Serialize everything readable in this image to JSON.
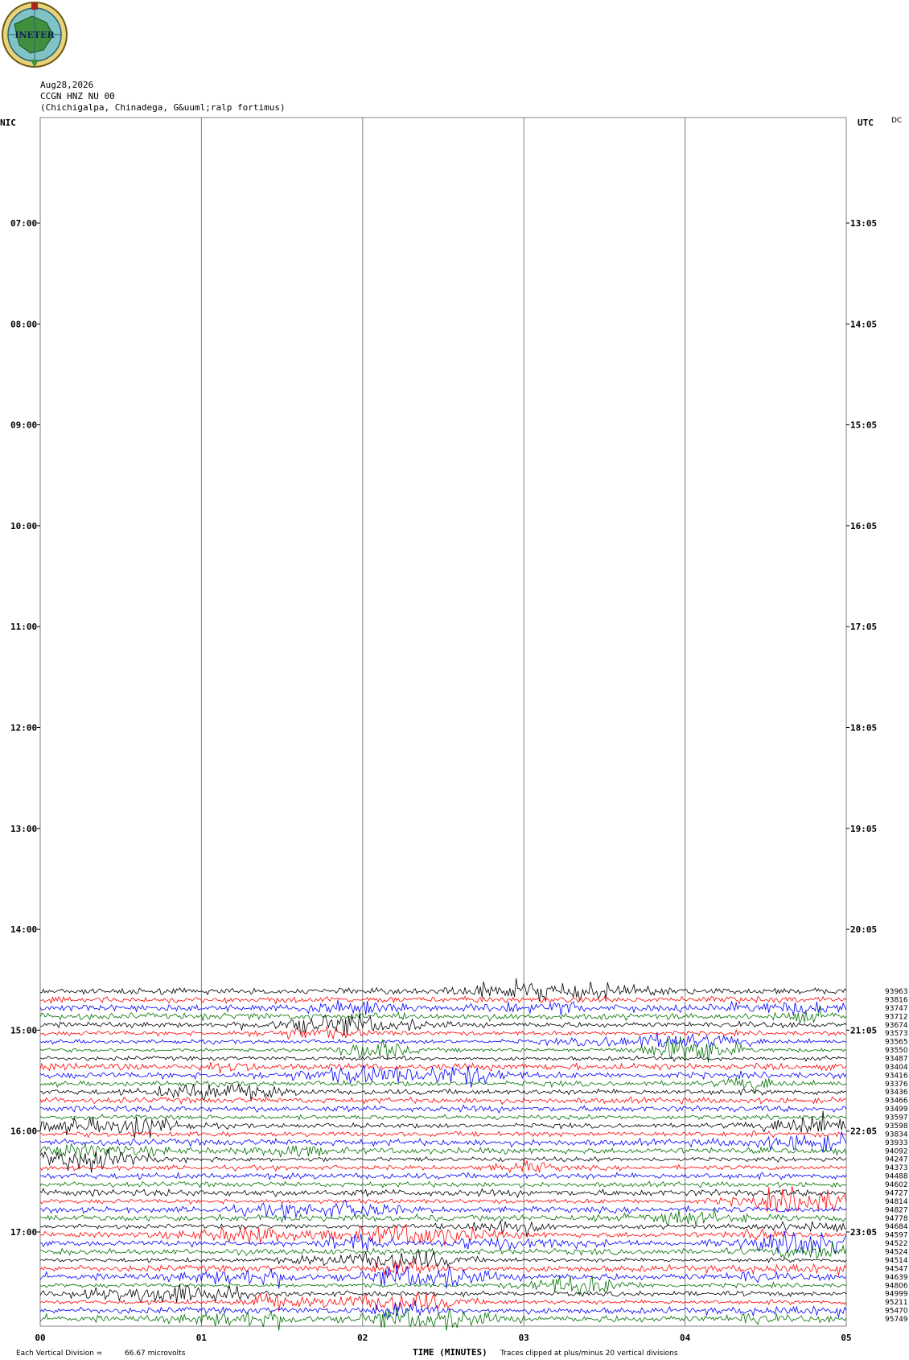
{
  "header": {
    "date": "Aug28,2026",
    "station": "CCGN HNZ NU 00",
    "location": "(Chichigalpa, Chinadega, G&uuml;ralp fortimus)",
    "dc": "DC",
    "logo_text": "INETER"
  },
  "colors": {
    "grid": "#808080",
    "series": [
      "#000000",
      "#ff0000",
      "#0000ff",
      "#007000"
    ]
  },
  "chart_data": {
    "type": "line",
    "y_left_label": "NIC",
    "y_right_label": "UTC",
    "y_left_ticks": [
      "07:00",
      "08:00",
      "09:00",
      "10:00",
      "11:00",
      "12:00",
      "13:00",
      "14:00",
      "15:00",
      "16:00",
      "17:00"
    ],
    "y_right_ticks": [
      "13:05",
      "14:05",
      "15:05",
      "16:05",
      "17:05",
      "18:05",
      "19:05",
      "20:05",
      "21:05",
      "22:05",
      "23:05"
    ],
    "x_ticks": [
      "00",
      "01",
      "02",
      "03",
      "04",
      "05"
    ],
    "xlabel": "TIME (MINUTES)",
    "xlim": [
      0,
      5
    ],
    "scale_note": "Each Vertical Division =",
    "scale_value": "66.67 microvolts",
    "clip_note": "Traces clipped at plus/minus 20 vertical divisions",
    "trace_first_hour_offset": 7.75,
    "trace_step_hours": 0.0833,
    "trace_values": [
      "93963",
      "93816",
      "93747",
      "93712",
      "93674",
      "93573",
      "93565",
      "93550",
      "93487",
      "93404",
      "93416",
      "93376",
      "93436",
      "93466",
      "93499",
      "93597",
      "93598",
      "93834",
      "93933",
      "94092",
      "94247",
      "94373",
      "94488",
      "94602",
      "94727",
      "94814",
      "94827",
      "94778",
      "94684",
      "94597",
      "94522",
      "94524",
      "94514",
      "94547",
      "94639",
      "94806",
      "94999",
      "95211",
      "95470",
      "95749"
    ]
  }
}
